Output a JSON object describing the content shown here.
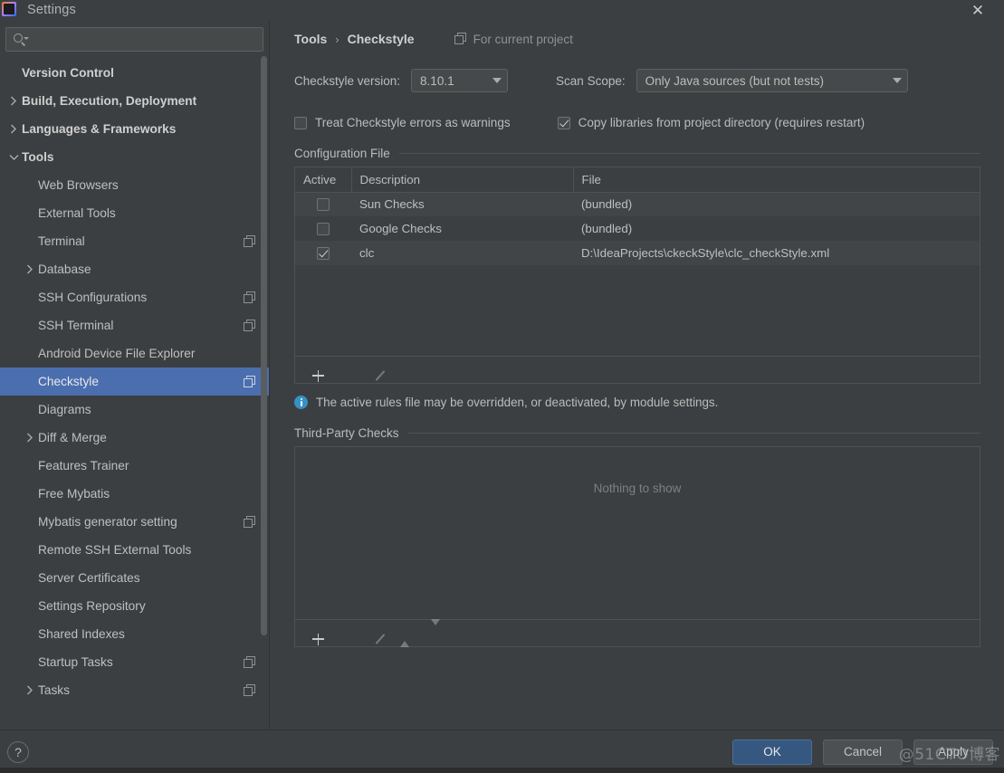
{
  "window": {
    "title": "Settings",
    "close_label": "✕",
    "logo_icon": "intellij-idea-logo"
  },
  "sidebar": {
    "search": {
      "value": "",
      "placeholder": "",
      "icon": "search-icon"
    },
    "items": [
      {
        "label": "Version Control",
        "indent": 0,
        "arrow": "none",
        "bold": true,
        "icon": null
      },
      {
        "label": "Build, Execution, Deployment",
        "indent": 0,
        "arrow": "right",
        "bold": true,
        "icon": null
      },
      {
        "label": "Languages & Frameworks",
        "indent": 0,
        "arrow": "right",
        "bold": true,
        "icon": null
      },
      {
        "label": "Tools",
        "indent": 0,
        "arrow": "down",
        "bold": true,
        "icon": null
      },
      {
        "label": "Web Browsers",
        "indent": 1,
        "arrow": "none",
        "bold": false,
        "icon": null
      },
      {
        "label": "External Tools",
        "indent": 1,
        "arrow": "none",
        "bold": false,
        "icon": null
      },
      {
        "label": "Terminal",
        "indent": 1,
        "arrow": "none",
        "bold": false,
        "icon": "project-scope-icon"
      },
      {
        "label": "Database",
        "indent": 1,
        "arrow": "right",
        "bold": false,
        "icon": null
      },
      {
        "label": "SSH Configurations",
        "indent": 1,
        "arrow": "none",
        "bold": false,
        "icon": "project-scope-icon"
      },
      {
        "label": "SSH Terminal",
        "indent": 1,
        "arrow": "none",
        "bold": false,
        "icon": "project-scope-icon"
      },
      {
        "label": "Android Device File Explorer",
        "indent": 1,
        "arrow": "none",
        "bold": false,
        "icon": null
      },
      {
        "label": "Checkstyle",
        "indent": 1,
        "arrow": "none",
        "bold": false,
        "icon": "project-scope-icon",
        "selected": true
      },
      {
        "label": "Diagrams",
        "indent": 1,
        "arrow": "none",
        "bold": false,
        "icon": null
      },
      {
        "label": "Diff & Merge",
        "indent": 1,
        "arrow": "right",
        "bold": false,
        "icon": null
      },
      {
        "label": "Features Trainer",
        "indent": 1,
        "arrow": "none",
        "bold": false,
        "icon": null
      },
      {
        "label": "Free Mybatis",
        "indent": 1,
        "arrow": "none",
        "bold": false,
        "icon": null
      },
      {
        "label": "Mybatis generator setting",
        "indent": 1,
        "arrow": "none",
        "bold": false,
        "icon": "project-scope-icon"
      },
      {
        "label": "Remote SSH External Tools",
        "indent": 1,
        "arrow": "none",
        "bold": false,
        "icon": null
      },
      {
        "label": "Server Certificates",
        "indent": 1,
        "arrow": "none",
        "bold": false,
        "icon": null
      },
      {
        "label": "Settings Repository",
        "indent": 1,
        "arrow": "none",
        "bold": false,
        "icon": null
      },
      {
        "label": "Shared Indexes",
        "indent": 1,
        "arrow": "none",
        "bold": false,
        "icon": null
      },
      {
        "label": "Startup Tasks",
        "indent": 1,
        "arrow": "none",
        "bold": false,
        "icon": "project-scope-icon"
      },
      {
        "label": "Tasks",
        "indent": 1,
        "arrow": "right",
        "bold": false,
        "icon": "project-scope-icon"
      }
    ]
  },
  "main": {
    "breadcrumb": {
      "parent": "Tools",
      "separator": "›",
      "current": "Checkstyle"
    },
    "scope_badge": {
      "label": "For current project",
      "icon": "project-scope-icon"
    },
    "version_field": {
      "label": "Checkstyle version:",
      "value": "8.10.1"
    },
    "scan_scope_field": {
      "label": "Scan Scope:",
      "value": "Only Java sources (but not tests)"
    },
    "checkbox_warnings": {
      "label": "Treat Checkstyle errors as warnings",
      "checked": false
    },
    "checkbox_copy_libs": {
      "label": "Copy libraries from project directory (requires restart)",
      "checked": true
    },
    "config_section": {
      "title": "Configuration File",
      "columns": [
        "Active",
        "Description",
        "File"
      ],
      "rows": [
        {
          "active": false,
          "description": "Sun Checks",
          "file": "(bundled)"
        },
        {
          "active": false,
          "description": "Google Checks",
          "file": "(bundled)"
        },
        {
          "active": true,
          "description": "clc",
          "file": "D:\\IdeaProjects\\ckeckStyle\\clc_checkStyle.xml"
        }
      ],
      "toolbar": [
        {
          "icon": "plus-icon",
          "enabled": true
        },
        {
          "icon": "minus-icon",
          "enabled": false
        },
        {
          "icon": "pencil-icon",
          "enabled": false
        }
      ]
    },
    "note": {
      "icon": "info-icon",
      "text": "The active rules file may be overridden, or deactivated, by module settings."
    },
    "third_party_section": {
      "title": "Third-Party Checks",
      "empty_message": "Nothing to show",
      "toolbar": [
        {
          "icon": "plus-icon",
          "enabled": true
        },
        {
          "icon": "minus-icon",
          "enabled": false
        },
        {
          "icon": "pencil-icon",
          "enabled": false
        },
        {
          "icon": "arrow-up-icon",
          "enabled": false
        },
        {
          "icon": "arrow-down-icon",
          "enabled": false
        }
      ]
    }
  },
  "footer": {
    "help_label": "?",
    "ok_label": "OK",
    "cancel_label": "Cancel",
    "apply_label": "Apply"
  },
  "watermark": {
    "text": "@51CTO博客"
  },
  "colors": {
    "background": "#3c3f41",
    "selection_blue": "#4b6eaf",
    "primary_button": "#365880",
    "info_blue": "#3592c4",
    "border": "#4e5254",
    "text": "#bbbbbb"
  }
}
